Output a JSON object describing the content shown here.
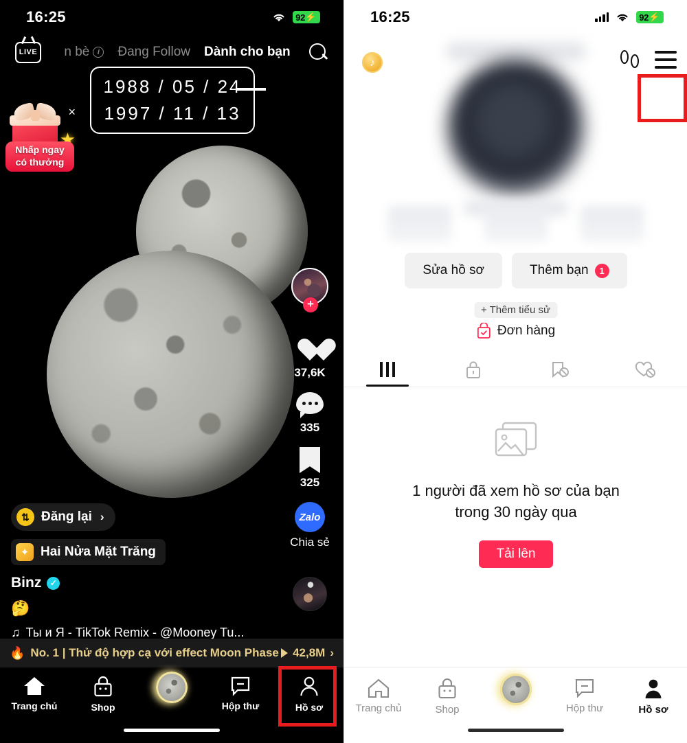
{
  "accent": {
    "tiktok_pink": "#fe2c55",
    "highlight_red": "#e81c1c",
    "battery_green": "#32d74b",
    "gold": "#e8cf8b"
  },
  "status_bar": {
    "time": "16:25",
    "battery": "92",
    "icons": [
      "cellular-signal-icon",
      "wifi-icon",
      "battery-charging-icon"
    ]
  },
  "feed_screen": {
    "live_label": "LIVE",
    "nav_tabs": [
      {
        "label": "n bè",
        "active": false,
        "has_info_icon": true
      },
      {
        "label": "Đang Follow",
        "active": false
      },
      {
        "label": "Dành cho bạn",
        "active": true
      }
    ],
    "search_icon": "search-icon",
    "date_sticker": {
      "line1": "1988 / 05 / 24",
      "line2": "1997 / 11 / 13"
    },
    "gift_promo": {
      "line1": "Nhấp ngay",
      "line2": "có thưởng",
      "close": "×"
    },
    "rail": {
      "avatar": "creator-avatar",
      "follow_plus": "+",
      "items": [
        {
          "icon": "heart-icon",
          "count": "37,6K"
        },
        {
          "icon": "comment-icon",
          "count": "335"
        },
        {
          "icon": "bookmark-icon",
          "count": "325"
        }
      ],
      "share": {
        "icon": "zalo-icon",
        "icon_label": "Zalo",
        "label": "Chia sẻ"
      },
      "music_disc": "music-disc-icon"
    },
    "meta": {
      "repost_label": "Đăng lại",
      "repost_chevron": "›",
      "effect_label": "Hai Nửa Mặt Trăng",
      "author": "Binz",
      "verified": "✓",
      "caption_emoji": "🤔",
      "song": "Ты и Я - TikTok Remix - @Mooney Tu...",
      "music_note": "♫"
    },
    "promo_banner": {
      "flame": "🔥",
      "text": "No. 1 | Thử độ hợp cạ với effect Moon Phase",
      "views": "42,8M",
      "chevron": "›"
    },
    "tabbar": [
      {
        "label": "Trang chủ",
        "icon": "home-icon",
        "active": true
      },
      {
        "label": "Shop",
        "icon": "shop-bag-icon",
        "active": false
      },
      {
        "label": "",
        "icon": "moon-create-icon",
        "active": false
      },
      {
        "label": "Hộp thư",
        "icon": "inbox-icon",
        "active": false
      },
      {
        "label": "Hồ sơ",
        "icon": "profile-person-icon",
        "active": false,
        "highlighted": true
      }
    ]
  },
  "profile_screen": {
    "coin_icon": "tiktok-coin-icon",
    "footprints_icon": "footprints-icon",
    "menu_icon": "hamburger-menu-icon",
    "menu_highlighted": true,
    "avatar": "profile-avatar-blurred",
    "username": "blurred",
    "handle": "blurred",
    "stats_blurred": [
      "following",
      "followers",
      "likes"
    ],
    "buttons": [
      {
        "label": "Sửa hồ sơ",
        "name": "edit-profile-button"
      },
      {
        "label": "Thêm bạn",
        "badge": "1",
        "name": "add-friends-button"
      }
    ],
    "add_bio": "+ Thêm tiểu sử",
    "orders": {
      "label": "Đơn hàng",
      "icon": "orders-bag-icon"
    },
    "tabs": [
      {
        "icon": "grid-videos-icon",
        "active": true
      },
      {
        "icon": "lock-private-icon",
        "active": false
      },
      {
        "icon": "bookmark-hidden-icon",
        "active": false
      },
      {
        "icon": "heart-hidden-icon",
        "active": false
      }
    ],
    "empty_state": {
      "icon": "photo-placeholder-icon",
      "line1": "1 người đã xem hồ sơ của bạn",
      "line2": "trong 30 ngày qua",
      "upload_label": "Tải lên"
    },
    "tabbar": [
      {
        "label": "Trang chủ",
        "icon": "home-icon",
        "active": false
      },
      {
        "label": "Shop",
        "icon": "shop-bag-icon",
        "active": false
      },
      {
        "label": "",
        "icon": "moon-create-icon",
        "active": false
      },
      {
        "label": "Hộp thư",
        "icon": "inbox-icon",
        "active": false
      },
      {
        "label": "Hồ sơ",
        "icon": "profile-person-icon",
        "active": true
      }
    ]
  }
}
